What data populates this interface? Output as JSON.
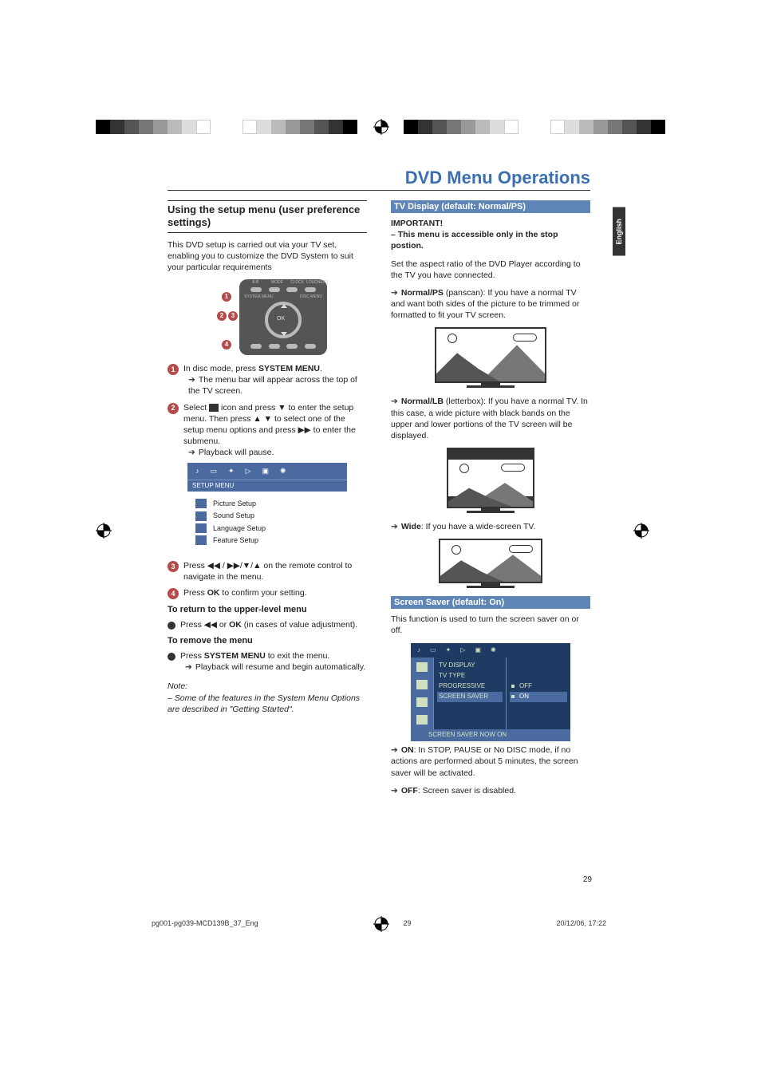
{
  "header": {
    "title": "DVD Menu Operations",
    "language_tab": "English"
  },
  "left": {
    "section_heading": "Using the setup menu (user preference settings)",
    "intro": "This DVD setup is carried out via your TV set, enabling you to customize the DVD System to suit your particular requirements",
    "remote": {
      "top_labels": [
        "A-B",
        "MODE",
        "CLOCK",
        "LOUDNESS"
      ],
      "mid_labels": [
        "SYSTEM MENU",
        "DISC MENU"
      ],
      "ok": "OK",
      "annotations": [
        "1",
        "2",
        "3",
        "4"
      ]
    },
    "step1": {
      "pre": "In disc mode, press ",
      "bold": "SYSTEM MENU",
      "post": ".",
      "arrow": "The menu bar will appear across the top of the TV screen."
    },
    "step2": {
      "pre": "Select ",
      "mid1": " icon and press ▼ to enter the setup menu.  Then press ▲ ▼ to select one of the setup menu options and press ",
      "ff": "▶▶",
      "mid2": " to enter the submenu.",
      "arrow": "Playback will pause."
    },
    "setup": {
      "label": "SETUP MENU",
      "items": [
        "Picture Setup",
        "Sound Setup",
        "Language Setup",
        "Feature Setup"
      ]
    },
    "step3": {
      "pre": "Press ",
      "rw": "◀◀",
      "mid": " / ",
      "ff": "▶▶",
      "post": "/▼/▲ on the remote control to navigate in the menu."
    },
    "step4": {
      "pre": "Press ",
      "bold": "OK",
      "post": " to confirm your setting."
    },
    "return_head": "To return to the upper-level menu",
    "return_body": {
      "pre": "Press ",
      "rw": "◀◀",
      "mid": " or ",
      "bold": "OK",
      "post": " (in cases of value adjustment)."
    },
    "remove_head": "To remove the menu",
    "remove_body": {
      "pre": "Press ",
      "bold": "SYSTEM MENU",
      "post": " to exit the menu."
    },
    "remove_arrow": "Playback will resume and begin automatically.",
    "note_label": "Note:",
    "note_body": "–  Some of the features in the System Menu Options are described in \"Getting Started\"."
  },
  "right": {
    "tv_display_head": "TV Display (default: Normal/PS)",
    "important": "IMPORTANT!",
    "important_body": "–  This menu is accessible only in the stop postion.",
    "aspect_intro": "Set the aspect ratio of the DVD Player according to the TV you have connected.",
    "normal_ps": {
      "bold": "Normal/PS",
      "body": " (panscan): If you have a normal TV and want both sides of the picture to be trimmed or formatted to fit your TV screen."
    },
    "normal_lb": {
      "bold": "Normal/LB",
      "body": " (letterbox): If you have a normal TV. In this case, a wide picture with black bands on the upper and lower portions of the TV screen will be displayed."
    },
    "wide": {
      "bold": "Wide",
      "body": ": If you have a wide-screen TV."
    },
    "ss_head": "Screen Saver (default:  On)",
    "ss_intro": "This function is used to turn the screen saver on or off.",
    "osd": {
      "menu": [
        "TV DISPLAY",
        "TV TYPE",
        "PROGRESSIVE",
        "SCREEN SAVER"
      ],
      "opts": [
        "OFF",
        "ON"
      ],
      "status": "SCREEN SAVER NOW ON"
    },
    "ss_on": {
      "bold": "ON",
      "body": ": In STOP, PAUSE or No DISC mode, if no actions are performed about 5 minutes, the screen saver will be activated."
    },
    "ss_off": {
      "bold": "OFF",
      "body": ":  Screen saver is disabled."
    }
  },
  "footer": {
    "file": "pg001-pg039-MCD139B_37_Eng",
    "page_inline": "29",
    "date": "20/12/06, 17:22",
    "page_number": "29"
  }
}
